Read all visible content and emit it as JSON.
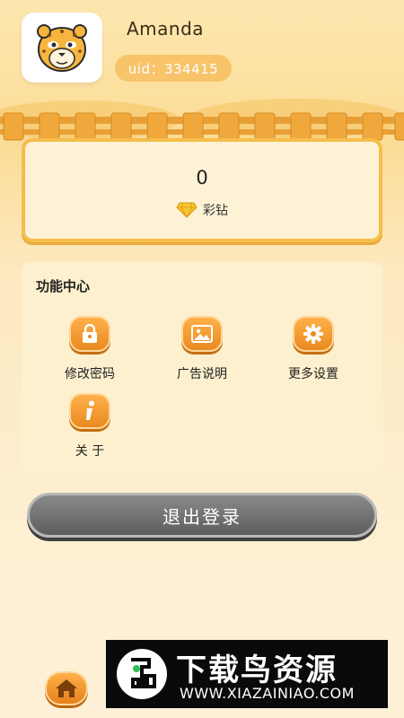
{
  "profile": {
    "avatar_icon": "cheetah-avatar-icon",
    "username": "Amanda",
    "uid_text": "uid：334415"
  },
  "balance": {
    "value": "0",
    "label": "彩钻",
    "icon": "diamond-icon"
  },
  "function_center": {
    "title": "功能中心",
    "items": [
      {
        "label": "修改密码",
        "icon": "lock-icon"
      },
      {
        "label": "广告说明",
        "icon": "image-icon"
      },
      {
        "label": "更多设置",
        "icon": "gear-icon"
      },
      {
        "label": "关 于",
        "icon": "info-icon"
      }
    ]
  },
  "logout": {
    "label": "退出登录"
  },
  "bottom_nav": {
    "home_icon": "home-icon"
  },
  "watermark": {
    "title": "下载鸟资源",
    "url": "WWW.XIAZAINIAO.COM"
  },
  "colors": {
    "accent_orange": "#f0962a",
    "card_border": "#f5bd4a",
    "logout_gray": "#6e6e6e"
  }
}
